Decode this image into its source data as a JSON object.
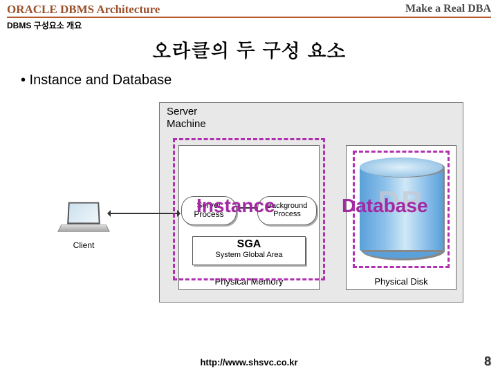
{
  "header": {
    "left": "ORACLE DBMS Architecture",
    "right": "Make a Real DBA"
  },
  "subtitle": "DBMS 구성요소 개요",
  "title": "오라클의 두 구성 요소",
  "bullet": "• Instance and Database",
  "diagram": {
    "server_machine": "Server\nMachine",
    "server_process": "Server\nProcess",
    "background_process": "Background\nProcess",
    "sga_big": "SGA",
    "sga_small": "System Global Area",
    "physical_memory": "Physical Memory",
    "physical_disk": "Physical Disk",
    "db_text": "DB",
    "instance_overlay": "Instance",
    "database_overlay": "Database",
    "client": "Client"
  },
  "footer": {
    "url": "http://www.shsvc.co.kr",
    "page": "8"
  }
}
